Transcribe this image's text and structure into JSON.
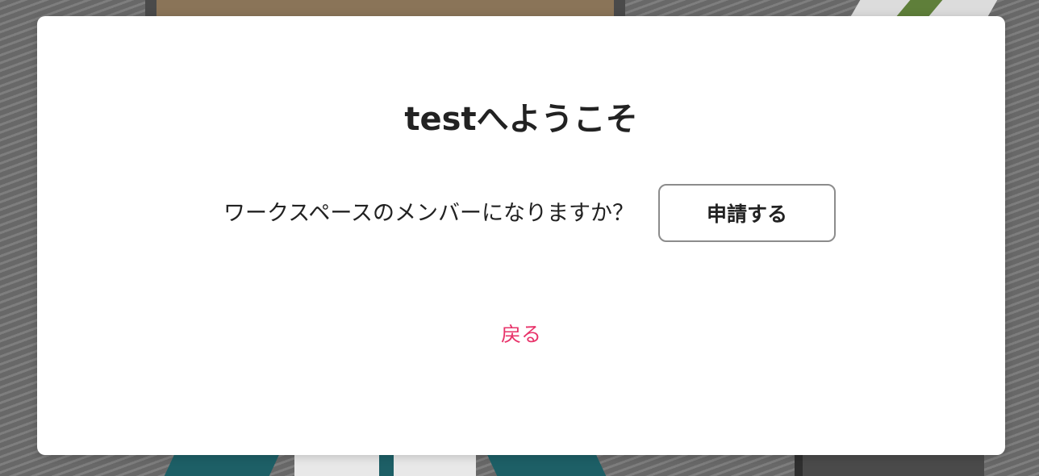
{
  "dialog": {
    "title": "testへようこそ",
    "question": "ワークスペースのメンバーになりますか？",
    "apply_label": "申請する",
    "back_label": "戻る"
  },
  "colors": {
    "link": "#e8336a",
    "text": "#222222",
    "button_border": "#8c8c8c",
    "overlay": "#6f6f6f"
  }
}
